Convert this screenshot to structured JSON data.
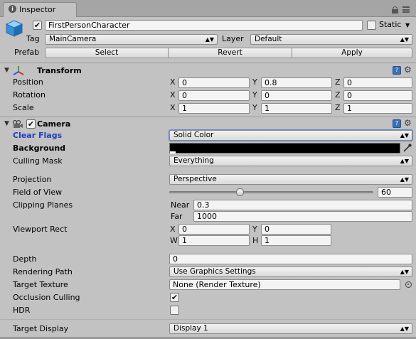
{
  "tab": {
    "label": "Inspector",
    "icon": "info-icon"
  },
  "gameobject": {
    "active": true,
    "name": "FirstPersonCharacter",
    "static_label": "Static",
    "static_checked": false,
    "tag_label": "Tag",
    "tag_value": "MainCamera",
    "layer_label": "Layer",
    "layer_value": "Default",
    "prefab_label": "Prefab",
    "select_label": "Select",
    "revert_label": "Revert",
    "apply_label": "Apply"
  },
  "transform": {
    "title": "Transform",
    "position_label": "Position",
    "rotation_label": "Rotation",
    "scale_label": "Scale",
    "x": "X",
    "y": "Y",
    "z": "Z",
    "position": {
      "x": "0",
      "y": "0.8",
      "z": "0"
    },
    "rotation": {
      "x": "0",
      "y": "0",
      "z": "0"
    },
    "scale": {
      "x": "1",
      "y": "1",
      "z": "1"
    }
  },
  "camera": {
    "title": "Camera",
    "enabled": true,
    "clear_flags_label": "Clear Flags",
    "clear_flags_value": "Solid Color",
    "background_label": "Background",
    "background_color": "#000000",
    "culling_mask_label": "Culling Mask",
    "culling_mask_value": "Everything",
    "projection_label": "Projection",
    "projection_value": "Perspective",
    "fov_label": "Field of View",
    "fov_value": "60",
    "fov_slider_fraction": 0.34,
    "clipping_label": "Clipping Planes",
    "near_label": "Near",
    "near_value": "0.3",
    "far_label": "Far",
    "far_value": "1000",
    "viewport_label": "Viewport Rect",
    "vp_x_label": "X",
    "vp_x": "0",
    "vp_y_label": "Y",
    "vp_y": "0",
    "vp_w_label": "W",
    "vp_w": "1",
    "vp_h_label": "H",
    "vp_h": "1",
    "depth_label": "Depth",
    "depth_value": "0",
    "rendering_path_label": "Rendering Path",
    "rendering_path_value": "Use Graphics Settings",
    "target_texture_label": "Target Texture",
    "target_texture_value": "None (Render Texture)",
    "occlusion_label": "Occlusion Culling",
    "occlusion_checked": true,
    "hdr_label": "HDR",
    "hdr_checked": false,
    "target_display_label": "Target Display",
    "target_display_value": "Display 1"
  },
  "colors": {
    "accent_blue": "#1f3fbf",
    "panel_bg": "#c2c2c2",
    "tab_bar": "#a5a5a5"
  }
}
